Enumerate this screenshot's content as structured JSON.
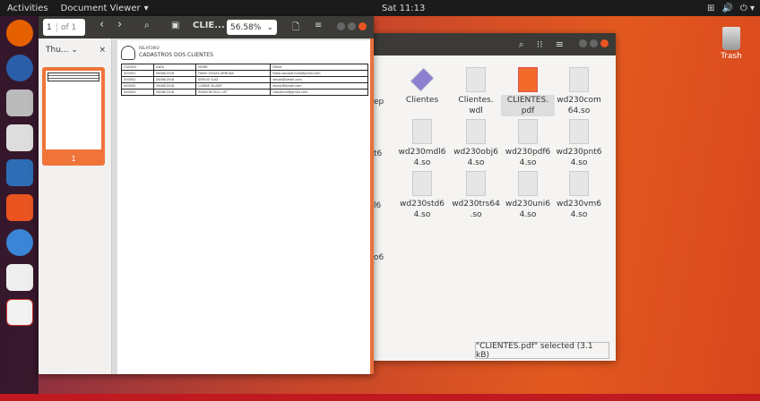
{
  "topbar": {
    "activities": "Activities",
    "app": "Document Viewer",
    "app_arrow": "▾",
    "clock": "Sat 11:13",
    "tray": [
      "⊞",
      "🔊",
      "⏻ ▾"
    ]
  },
  "desktop": {
    "trash_label": "Trash"
  },
  "viewer": {
    "page_current": "1",
    "page_of": "of 1",
    "prev": "‹",
    "next": "›",
    "search": "⌕",
    "title": "CLIE...",
    "zoom": "56.58%",
    "zoom_arrow": "⌄",
    "menu": "≡",
    "sidebar_mode": "Thu...",
    "sidebar_arrow": "⌄",
    "sidebar_close": "×",
    "thumb_page": "1",
    "report": {
      "label": "RELATORIO",
      "title": "CADASTROS DOS CLIENTES",
      "columns": [
        "CODIGO",
        "DATA",
        "NOME",
        "EMAIL"
      ],
      "rows": [
        [
          "000001",
          "06/06/2018",
          "FABIO SOUZA ARRUDA",
          "fabio.souzaarruda@gmail.com"
        ],
        [
          "000002",
          "06/06/2018",
          "SERGIO LUIZ",
          "sergio@gmail.com"
        ],
        [
          "000003",
          "06/06/2018",
          "CONDE VILADY",
          "vilady@gmail.com"
        ],
        [
          "000004",
          "06/06/2018",
          "ROBSON ROLL LET",
          "robsonroll@gmail.com"
        ]
      ]
    }
  },
  "files": {
    "items": [
      {
        "name": "Clientes"
      },
      {
        "name": "Clientes.\nwdl"
      },
      {
        "name": "CLIENTES.\npdf",
        "selected": true
      },
      {
        "name": "wd230com\n64.so"
      },
      {
        "name": "wd230mdl6\n4.so"
      },
      {
        "name": "wd230obj6\n4.so"
      },
      {
        "name": "wd230pdf6\n4.so"
      },
      {
        "name": "wd230pnt6\n4.so"
      },
      {
        "name": "wd230std6\n4.so"
      },
      {
        "name": "wd230trs64\n.so"
      },
      {
        "name": "wd230uni6\n4.so"
      },
      {
        "name": "wd230vm6\n4.so"
      }
    ],
    "partials": [
      "ep",
      "t6",
      "l6",
      "o6"
    ],
    "status": "\"CLIENTES.pdf\" selected (3.1 kB)"
  }
}
